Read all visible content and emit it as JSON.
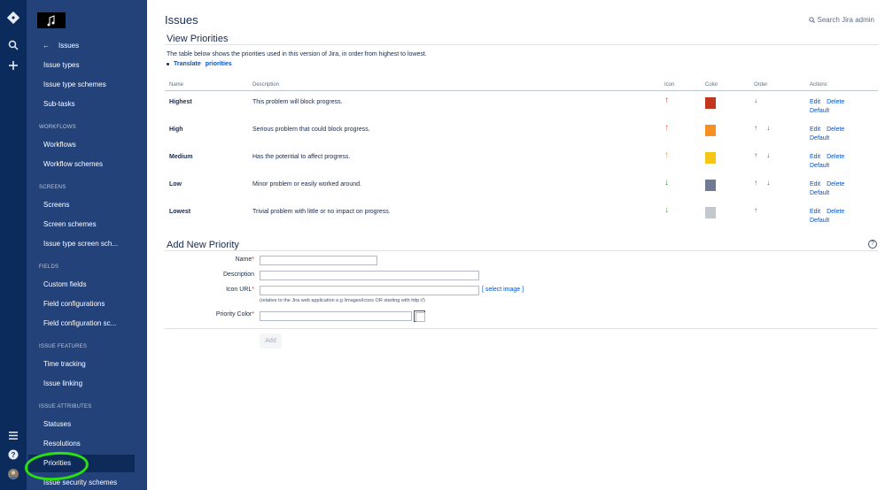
{
  "sidebar": {
    "back_label": "Issues",
    "items": [
      {
        "label": "Issue types"
      },
      {
        "label": "Issue type schemes"
      },
      {
        "label": "Sub-tasks"
      },
      {
        "label": "Workflows"
      },
      {
        "label": "Workflow schemes"
      },
      {
        "label": "Screens"
      },
      {
        "label": "Screen schemes"
      },
      {
        "label": "Issue type screen sch..."
      },
      {
        "label": "Custom fields"
      },
      {
        "label": "Field configurations"
      },
      {
        "label": "Field configuration sc..."
      },
      {
        "label": "Time tracking"
      },
      {
        "label": "Issue linking"
      },
      {
        "label": "Statuses"
      },
      {
        "label": "Resolutions"
      },
      {
        "label": "Priorities"
      },
      {
        "label": "Issue security schemes"
      }
    ],
    "sections": [
      "WORKFLOWS",
      "SCREENS",
      "FIELDS",
      "ISSUE FEATURES",
      "ISSUE ATTRIBUTES"
    ]
  },
  "header": {
    "title": "Issues",
    "search_label": "Search Jira admin"
  },
  "view": {
    "title": "View Priorities",
    "description": "The table below shows the priorities used in this version of Jira, in order from highest to lowest.",
    "translate_link": "Translate",
    "translate_rest": "priorities"
  },
  "table": {
    "headers": {
      "name": "Name",
      "description": "Description",
      "icon": "Icon",
      "color": "Color",
      "order": "Order",
      "actions": "Actions"
    },
    "rows": [
      {
        "name": "Highest",
        "description": "This problem will block progress.",
        "icon": "↑",
        "icon_color": "#d04437",
        "color": "#c1371d",
        "order": "↓",
        "actions": [
          "Edit",
          "Delete",
          "Default"
        ]
      },
      {
        "name": "High",
        "description": "Serious problem that could block progress.",
        "icon": "↑",
        "icon_color": "#f15c46",
        "color": "#f79024",
        "order": "↑ ↓",
        "actions": [
          "Edit",
          "Delete",
          "Default"
        ]
      },
      {
        "name": "Medium",
        "description": "Has the potential to affect progress.",
        "icon": "↑",
        "icon_color": "#f79232",
        "color": "#f5c518",
        "order": "↑ ↓",
        "actions": [
          "Edit",
          "Delete",
          "Default"
        ]
      },
      {
        "name": "Low",
        "description": "Minor problem or easily worked around.",
        "icon": "↓",
        "icon_color": "#2a8735",
        "color": "#707a94",
        "order": "↑ ↓",
        "actions": [
          "Edit",
          "Delete",
          "Default"
        ]
      },
      {
        "name": "Lowest",
        "description": "Trivial problem with little or no impact on progress.",
        "icon": "↓",
        "icon_color": "#55a557",
        "color": "#c3c7ce",
        "order": "↑",
        "actions": [
          "Edit",
          "Delete",
          "Default"
        ]
      }
    ]
  },
  "add_form": {
    "title": "Add New Priority",
    "name_label": "Name",
    "description_label": "Description",
    "icon_url_label": "Icon URL",
    "icon_url_hint": "(relative to the Jira web application e.g /images/icons OR starting with http://)",
    "select_image": "[ select image ]",
    "color_label": "Priority Color",
    "add_button": "Add",
    "required_mark": "*"
  },
  "icons": {
    "home": "jira-logo-icon",
    "search": "search-icon",
    "create": "plus-icon",
    "menu": "menu-icon",
    "help": "help-icon",
    "avatar": "avatar"
  }
}
